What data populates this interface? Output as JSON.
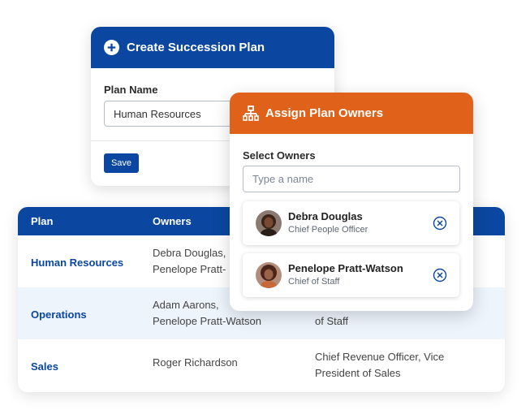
{
  "create_plan": {
    "title": "Create Succession Plan",
    "plan_name_label": "Plan Name",
    "plan_name_value": "Human Resources",
    "save_label": "Save",
    "header_color": "#0b47a0",
    "icon": "plus-circle-icon"
  },
  "assign_owners": {
    "title": "Assign Plan Owners",
    "header_color": "#e0621a",
    "icon": "org-chart-icon",
    "select_label": "Select Owners",
    "search_placeholder": "Type a name",
    "selected": [
      {
        "name": "Debra Douglas",
        "role": "Chief People Officer",
        "remove_icon": "remove-circle-icon"
      },
      {
        "name": "Penelope Pratt-Watson",
        "role": "Chief of Staff",
        "remove_icon": "remove-circle-icon"
      }
    ]
  },
  "plans_table": {
    "columns": [
      "Plan",
      "Owners"
    ],
    "rows": [
      {
        "plan": "Human Resources",
        "owners": [
          "Debra Douglas,",
          "Penelope Pratt-"
        ],
        "titles": []
      },
      {
        "plan": "Operations",
        "owners": [
          "Adam Aarons,",
          "Penelope Pratt-Watson"
        ],
        "titles": [
          "of Staff"
        ]
      },
      {
        "plan": "Sales",
        "owners": [
          "Roger Richardson"
        ],
        "titles": [
          "Chief Revenue Officer, Vice",
          "President of Sales"
        ]
      }
    ]
  }
}
